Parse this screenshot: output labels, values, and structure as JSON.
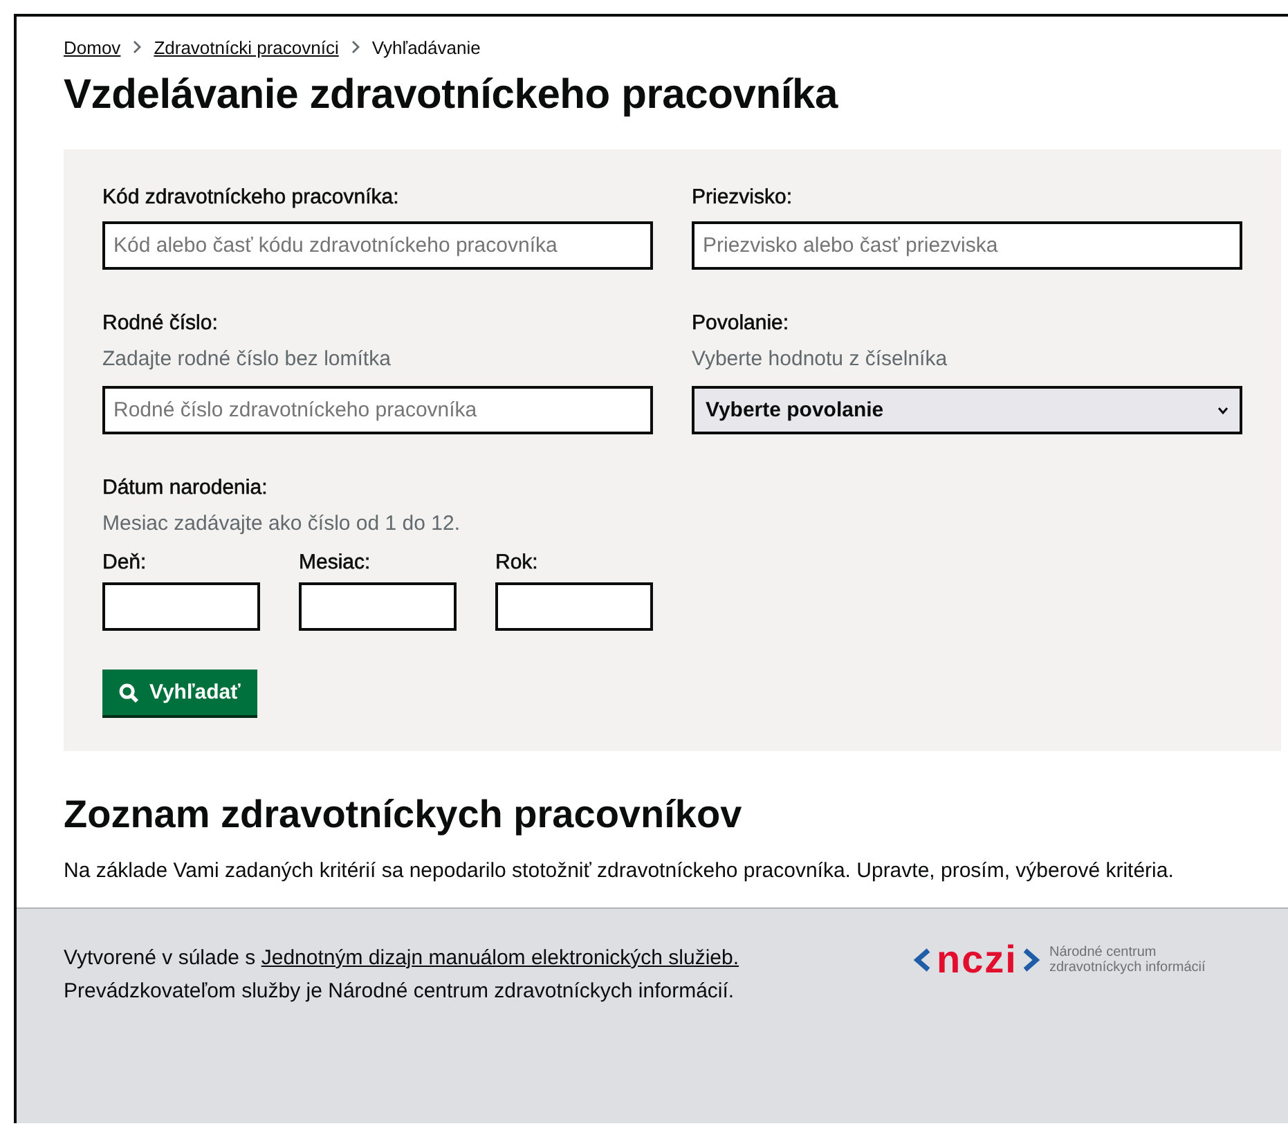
{
  "breadcrumbs": [
    {
      "label": "Domov",
      "link": true
    },
    {
      "label": "Zdravotnícki pracovníci",
      "link": true
    },
    {
      "label": "Vyhľadávanie",
      "link": false
    }
  ],
  "title": "Vzdelávanie zdravotníckeho pracovníka",
  "form": {
    "fields": [
      {
        "kind": "text",
        "label": "Kód zdravotníckeho pracovníka:",
        "placeholder": "Kód alebo časť kódu zdravotníckeho pracovníka"
      },
      {
        "kind": "text",
        "label": "Priezvisko:",
        "placeholder": "Priezvisko alebo časť priezviska"
      },
      {
        "kind": "text",
        "label": "Rodné číslo:",
        "hint": "Zadajte rodné číslo bez lomítka",
        "placeholder": "Rodné číslo zdravotníckeho pracovníka"
      },
      {
        "kind": "select",
        "label": "Povolanie:",
        "hint": "Vyberte hodnotu z číselníka",
        "value": "Vyberte povolanie"
      }
    ],
    "date": {
      "label": "Dátum narodenia:",
      "hint": "Mesiac zadávajte ako číslo od 1 do 12.",
      "parts": [
        "Deň:",
        "Mesiac:",
        "Rok:"
      ]
    },
    "search_button": "Vyhľadať"
  },
  "results": {
    "title": "Zoznam zdravotníckych pracovníkov",
    "message": "Na základe Vami zadaných kritérií sa nepodarilo stotožniť zdravotníckeho pracovníka. Upravte, prosím, výberové kritéria."
  },
  "footer": {
    "text_before": "Vytvorené v súlade s ",
    "link": "Jednotným dizajn manuálom elektronických služieb.",
    "operator": "Prevádzkovateľom služby je Národné centrum zdravotníckych informácií.",
    "logo": {
      "mark": "nczi",
      "caption": [
        "Národné centrum",
        "zdravotníckych informácií"
      ]
    }
  }
}
